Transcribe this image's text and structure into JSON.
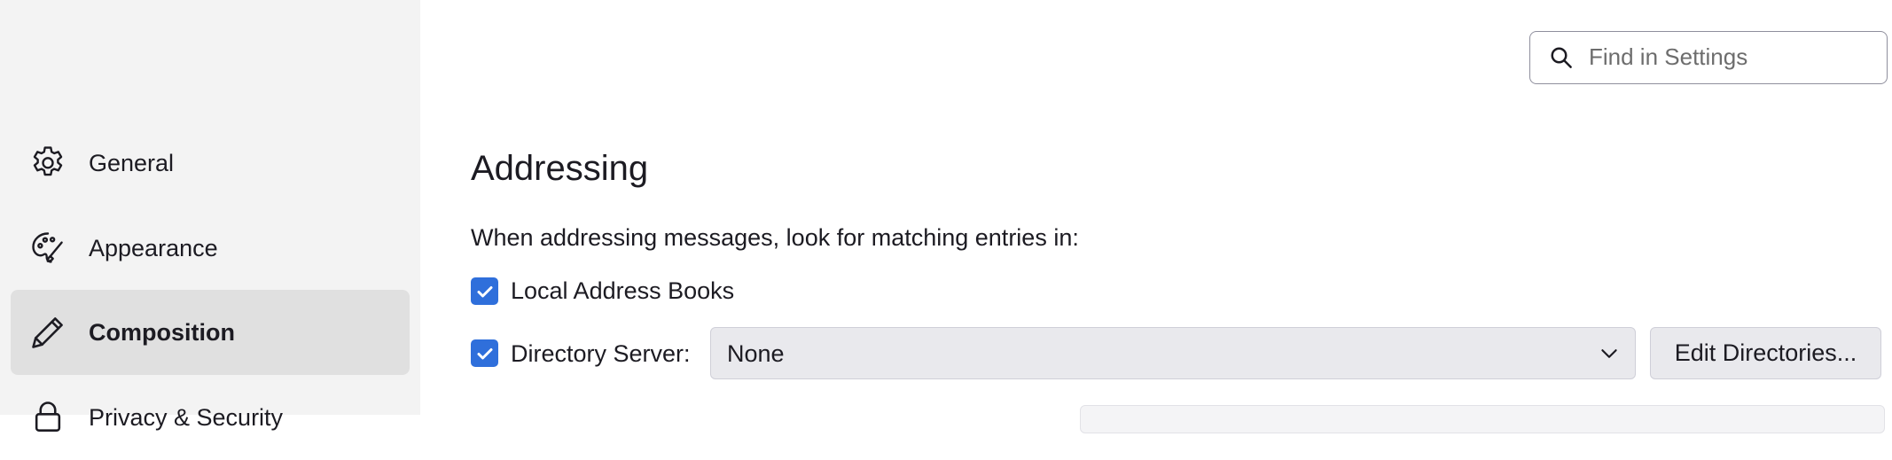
{
  "sidebar": {
    "items": [
      {
        "label": "General",
        "icon": "gear-icon",
        "selected": false
      },
      {
        "label": "Appearance",
        "icon": "palette-icon",
        "selected": false
      },
      {
        "label": "Composition",
        "icon": "pencil-icon",
        "selected": true
      },
      {
        "label": "Privacy & Security",
        "icon": "lock-icon",
        "selected": false
      }
    ]
  },
  "search": {
    "placeholder": "Find in Settings",
    "value": ""
  },
  "addressing": {
    "title": "Addressing",
    "description": "When addressing messages, look for matching entries in:",
    "local_address_books": {
      "label": "Local Address Books",
      "checked": true
    },
    "directory_server": {
      "label": "Directory Server:",
      "checked": true,
      "selected": "None",
      "edit_button": "Edit Directories..."
    }
  },
  "colors": {
    "accent": "#2f6fdb",
    "sidebar_bg": "#f3f3f3",
    "selected_bg": "#e0e0e0",
    "control_bg": "#e9e9ed"
  }
}
